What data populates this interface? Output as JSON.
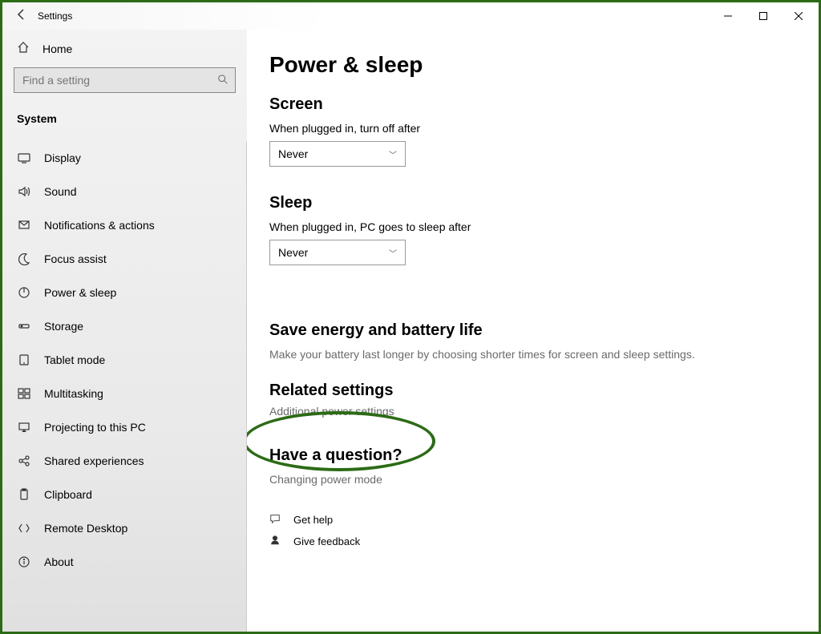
{
  "window": {
    "title": "Settings"
  },
  "sidebar": {
    "home_label": "Home",
    "search_placeholder": "Find a setting",
    "category_label": "System",
    "items": [
      {
        "label": "Display"
      },
      {
        "label": "Sound"
      },
      {
        "label": "Notifications & actions"
      },
      {
        "label": "Focus assist"
      },
      {
        "label": "Power & sleep"
      },
      {
        "label": "Storage"
      },
      {
        "label": "Tablet mode"
      },
      {
        "label": "Multitasking"
      },
      {
        "label": "Projecting to this PC"
      },
      {
        "label": "Shared experiences"
      },
      {
        "label": "Clipboard"
      },
      {
        "label": "Remote Desktop"
      },
      {
        "label": "About"
      }
    ]
  },
  "main": {
    "title": "Power & sleep",
    "screen": {
      "heading": "Screen",
      "label": "When plugged in, turn off after",
      "value": "Never"
    },
    "sleep": {
      "heading": "Sleep",
      "label": "When plugged in, PC goes to sleep after",
      "value": "Never"
    },
    "energy": {
      "heading": "Save energy and battery life",
      "text": "Make your battery last longer by choosing shorter times for screen and sleep settings."
    },
    "related": {
      "heading": "Related settings",
      "link": "Additional power settings"
    },
    "question": {
      "heading": "Have a question?",
      "link": "Changing power mode"
    },
    "help": {
      "get_help": "Get help",
      "feedback": "Give feedback"
    }
  }
}
